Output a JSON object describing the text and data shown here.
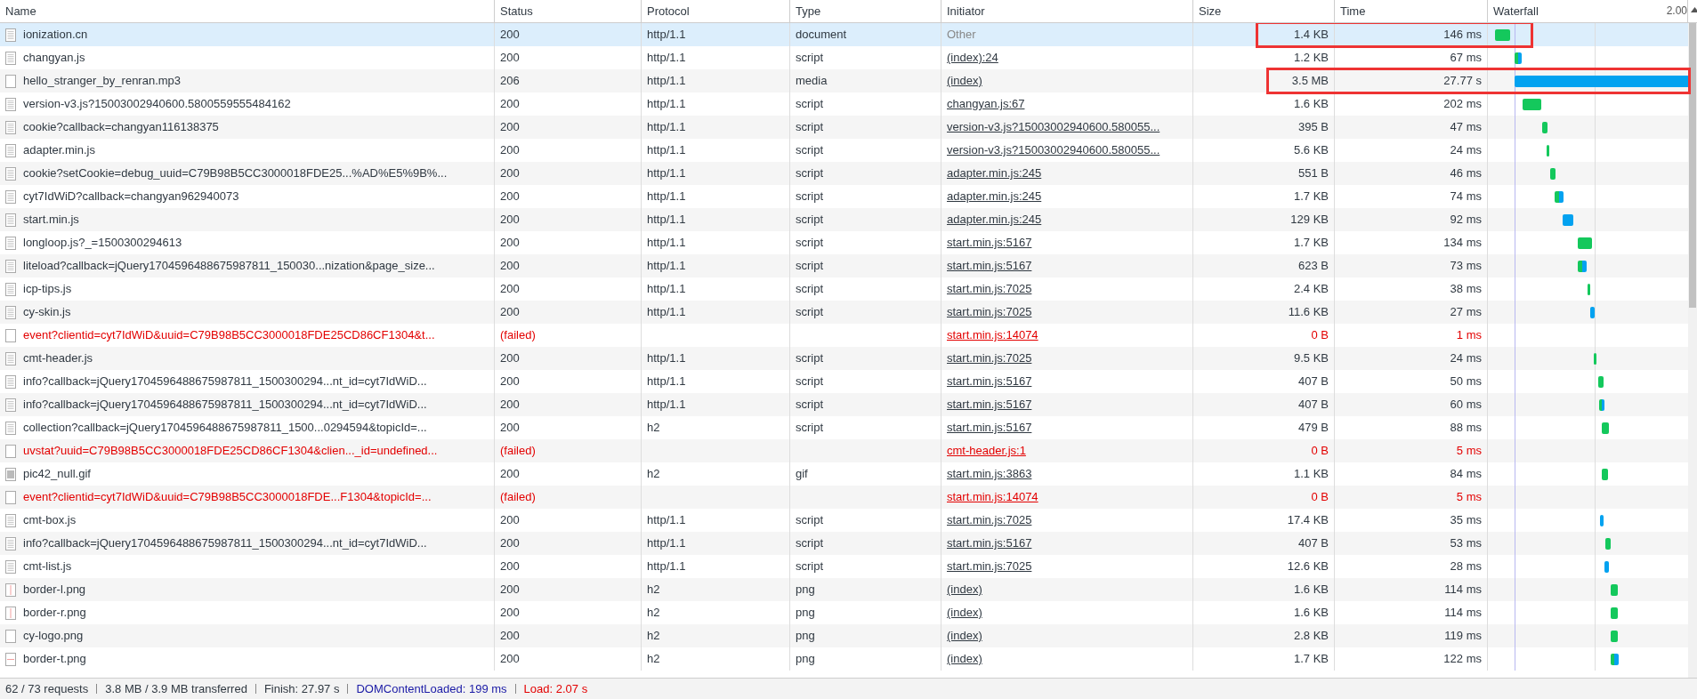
{
  "table": {
    "columns": [
      "Name",
      "Status",
      "Protocol",
      "Type",
      "Initiator",
      "Size",
      "Time",
      "Waterfall"
    ],
    "waterfall_tick": "2.00",
    "rows": [
      {
        "kind": "doc",
        "name": "ionization.cn",
        "status": "200",
        "protocol": "http/1.1",
        "type": "document",
        "initiator": "Other",
        "initiator_link": false,
        "size": "1.4 KB",
        "time": "146 ms",
        "selected": true,
        "failed": false,
        "annotated": true
      },
      {
        "kind": "doc",
        "name": "changyan.js",
        "status": "200",
        "protocol": "http/1.1",
        "type": "script",
        "initiator": "(index):24",
        "initiator_link": true,
        "size": "1.2 KB",
        "time": "67 ms",
        "selected": false,
        "failed": false,
        "annotated": false
      },
      {
        "kind": "blank",
        "name": "hello_stranger_by_renran.mp3",
        "status": "206",
        "protocol": "http/1.1",
        "type": "media",
        "initiator": "(index)",
        "initiator_link": true,
        "size": "3.5 MB",
        "time": "27.77 s",
        "selected": false,
        "failed": false,
        "annotated": true
      },
      {
        "kind": "doc",
        "name": "version-v3.js?15003002940600.5800559555484162",
        "status": "200",
        "protocol": "http/1.1",
        "type": "script",
        "initiator": "changyan.js:67",
        "initiator_link": true,
        "size": "1.6 KB",
        "time": "202 ms",
        "selected": false,
        "failed": false,
        "annotated": false
      },
      {
        "kind": "doc",
        "name": "cookie?callback=changyan116138375",
        "status": "200",
        "protocol": "http/1.1",
        "type": "script",
        "initiator": "version-v3.js?15003002940600.580055...",
        "initiator_link": true,
        "size": "395 B",
        "time": "47 ms",
        "selected": false,
        "failed": false,
        "annotated": false
      },
      {
        "kind": "doc",
        "name": "adapter.min.js",
        "status": "200",
        "protocol": "http/1.1",
        "type": "script",
        "initiator": "version-v3.js?15003002940600.580055...",
        "initiator_link": true,
        "size": "5.6 KB",
        "time": "24 ms",
        "selected": false,
        "failed": false,
        "annotated": false
      },
      {
        "kind": "doc",
        "name": "cookie?setCookie=debug_uuid=C79B98B5CC3000018FDE25...%AD%E5%9B%...",
        "status": "200",
        "protocol": "http/1.1",
        "type": "script",
        "initiator": "adapter.min.js:245",
        "initiator_link": true,
        "size": "551 B",
        "time": "46 ms",
        "selected": false,
        "failed": false,
        "annotated": false
      },
      {
        "kind": "doc",
        "name": "cyt7IdWiD?callback=changyan962940073",
        "status": "200",
        "protocol": "http/1.1",
        "type": "script",
        "initiator": "adapter.min.js:245",
        "initiator_link": true,
        "size": "1.7 KB",
        "time": "74 ms",
        "selected": false,
        "failed": false,
        "annotated": false
      },
      {
        "kind": "doc",
        "name": "start.min.js",
        "status": "200",
        "protocol": "http/1.1",
        "type": "script",
        "initiator": "adapter.min.js:245",
        "initiator_link": true,
        "size": "129 KB",
        "time": "92 ms",
        "selected": false,
        "failed": false,
        "annotated": false
      },
      {
        "kind": "doc",
        "name": "longloop.js?_=1500300294613",
        "status": "200",
        "protocol": "http/1.1",
        "type": "script",
        "initiator": "start.min.js:5167",
        "initiator_link": true,
        "size": "1.7 KB",
        "time": "134 ms",
        "selected": false,
        "failed": false,
        "annotated": false
      },
      {
        "kind": "doc",
        "name": "liteload?callback=jQuery1704596488675987811_150030...nization&page_size...",
        "status": "200",
        "protocol": "http/1.1",
        "type": "script",
        "initiator": "start.min.js:5167",
        "initiator_link": true,
        "size": "623 B",
        "time": "73 ms",
        "selected": false,
        "failed": false,
        "annotated": false
      },
      {
        "kind": "doc",
        "name": "icp-tips.js",
        "status": "200",
        "protocol": "http/1.1",
        "type": "script",
        "initiator": "start.min.js:7025",
        "initiator_link": true,
        "size": "2.4 KB",
        "time": "38 ms",
        "selected": false,
        "failed": false,
        "annotated": false
      },
      {
        "kind": "doc",
        "name": "cy-skin.js",
        "status": "200",
        "protocol": "http/1.1",
        "type": "script",
        "initiator": "start.min.js:7025",
        "initiator_link": true,
        "size": "11.6 KB",
        "time": "27 ms",
        "selected": false,
        "failed": false,
        "annotated": false
      },
      {
        "kind": "blank",
        "name": "event?clientid=cyt7IdWiD&uuid=C79B98B5CC3000018FDE25CD86CF1304&t...",
        "status": "(failed)",
        "initiator": "start.min.js:14074",
        "initiator_link": true,
        "size": "0 B",
        "time": "1 ms",
        "selected": false,
        "failed": true,
        "annotated": false
      },
      {
        "kind": "doc",
        "name": "cmt-header.js",
        "status": "200",
        "protocol": "http/1.1",
        "type": "script",
        "initiator": "start.min.js:7025",
        "initiator_link": true,
        "size": "9.5 KB",
        "time": "24 ms",
        "selected": false,
        "failed": false,
        "annotated": false
      },
      {
        "kind": "doc",
        "name": "info?callback=jQuery1704596488675987811_1500300294...nt_id=cyt7IdWiD...",
        "status": "200",
        "protocol": "http/1.1",
        "type": "script",
        "initiator": "start.min.js:5167",
        "initiator_link": true,
        "size": "407 B",
        "time": "50 ms",
        "selected": false,
        "failed": false,
        "annotated": false
      },
      {
        "kind": "doc",
        "name": "info?callback=jQuery1704596488675987811_1500300294...nt_id=cyt7IdWiD...",
        "status": "200",
        "protocol": "http/1.1",
        "type": "script",
        "initiator": "start.min.js:5167",
        "initiator_link": true,
        "size": "407 B",
        "time": "60 ms",
        "selected": false,
        "failed": false,
        "annotated": false
      },
      {
        "kind": "doc",
        "name": "collection?callback=jQuery1704596488675987811_1500...0294594&topicId=...",
        "status": "200",
        "protocol": "h2",
        "type": "script",
        "initiator": "start.min.js:5167",
        "initiator_link": true,
        "size": "479 B",
        "time": "88 ms",
        "selected": false,
        "failed": false,
        "annotated": false
      },
      {
        "kind": "blank",
        "name": "uvstat?uuid=C79B98B5CC3000018FDE25CD86CF1304&clien..._id=undefined...",
        "status": "(failed)",
        "initiator": "cmt-header.js:1",
        "initiator_link": true,
        "size": "0 B",
        "time": "5 ms",
        "selected": false,
        "failed": true,
        "annotated": false
      },
      {
        "kind": "image",
        "name": "pic42_null.gif",
        "status": "200",
        "protocol": "h2",
        "type": "gif",
        "initiator": "start.min.js:3863",
        "initiator_link": true,
        "size": "1.1 KB",
        "time": "84 ms",
        "selected": false,
        "failed": false,
        "annotated": false
      },
      {
        "kind": "blank",
        "name": "event?clientid=cyt7IdWiD&uuid=C79B98B5CC3000018FDE...F1304&topicId=...",
        "status": "(failed)",
        "initiator": "start.min.js:14074",
        "initiator_link": true,
        "size": "0 B",
        "time": "5 ms",
        "selected": false,
        "failed": true,
        "annotated": false
      },
      {
        "kind": "doc",
        "name": "cmt-box.js",
        "status": "200",
        "protocol": "http/1.1",
        "type": "script",
        "initiator": "start.min.js:7025",
        "initiator_link": true,
        "size": "17.4 KB",
        "time": "35 ms",
        "selected": false,
        "failed": false,
        "annotated": false
      },
      {
        "kind": "doc",
        "name": "info?callback=jQuery1704596488675987811_1500300294...nt_id=cyt7IdWiD...",
        "status": "200",
        "protocol": "http/1.1",
        "type": "script",
        "initiator": "start.min.js:5167",
        "initiator_link": true,
        "size": "407 B",
        "time": "53 ms",
        "selected": false,
        "failed": false,
        "annotated": false
      },
      {
        "kind": "doc",
        "name": "cmt-list.js",
        "status": "200",
        "protocol": "http/1.1",
        "type": "script",
        "initiator": "start.min.js:7025",
        "initiator_link": true,
        "size": "12.6 KB",
        "time": "28 ms",
        "selected": false,
        "failed": false,
        "annotated": false
      },
      {
        "kind": "vline",
        "name": "border-l.png",
        "status": "200",
        "protocol": "h2",
        "type": "png",
        "initiator": "(index)",
        "initiator_link": true,
        "size": "1.6 KB",
        "time": "114 ms",
        "selected": false,
        "failed": false,
        "annotated": false
      },
      {
        "kind": "vline",
        "name": "border-r.png",
        "status": "200",
        "protocol": "h2",
        "type": "png",
        "initiator": "(index)",
        "initiator_link": true,
        "size": "1.6 KB",
        "time": "114 ms",
        "selected": false,
        "failed": false,
        "annotated": false
      },
      {
        "kind": "blank",
        "name": "cy-logo.png",
        "status": "200",
        "protocol": "h2",
        "type": "png",
        "initiator": "(index)",
        "initiator_link": true,
        "size": "2.8 KB",
        "time": "119 ms",
        "selected": false,
        "failed": false,
        "annotated": false
      },
      {
        "kind": "hline",
        "name": "border-t.png",
        "status": "200",
        "protocol": "h2",
        "type": "png",
        "initiator": "(index)",
        "initiator_link": true,
        "size": "1.7 KB",
        "time": "122 ms",
        "selected": false,
        "failed": false,
        "annotated": false
      }
    ]
  },
  "status_bar": [
    {
      "kind": "plain",
      "text": "62 / 73 requests"
    },
    {
      "kind": "plain",
      "text": "3.8 MB / 3.9 MB transferred"
    },
    {
      "kind": "plain",
      "text": "Finish: 27.97 s"
    },
    {
      "kind": "dom",
      "text": "DOMContentLoaded: 199 ms"
    },
    {
      "kind": "load",
      "text": "Load: 2.07 s"
    }
  ]
}
